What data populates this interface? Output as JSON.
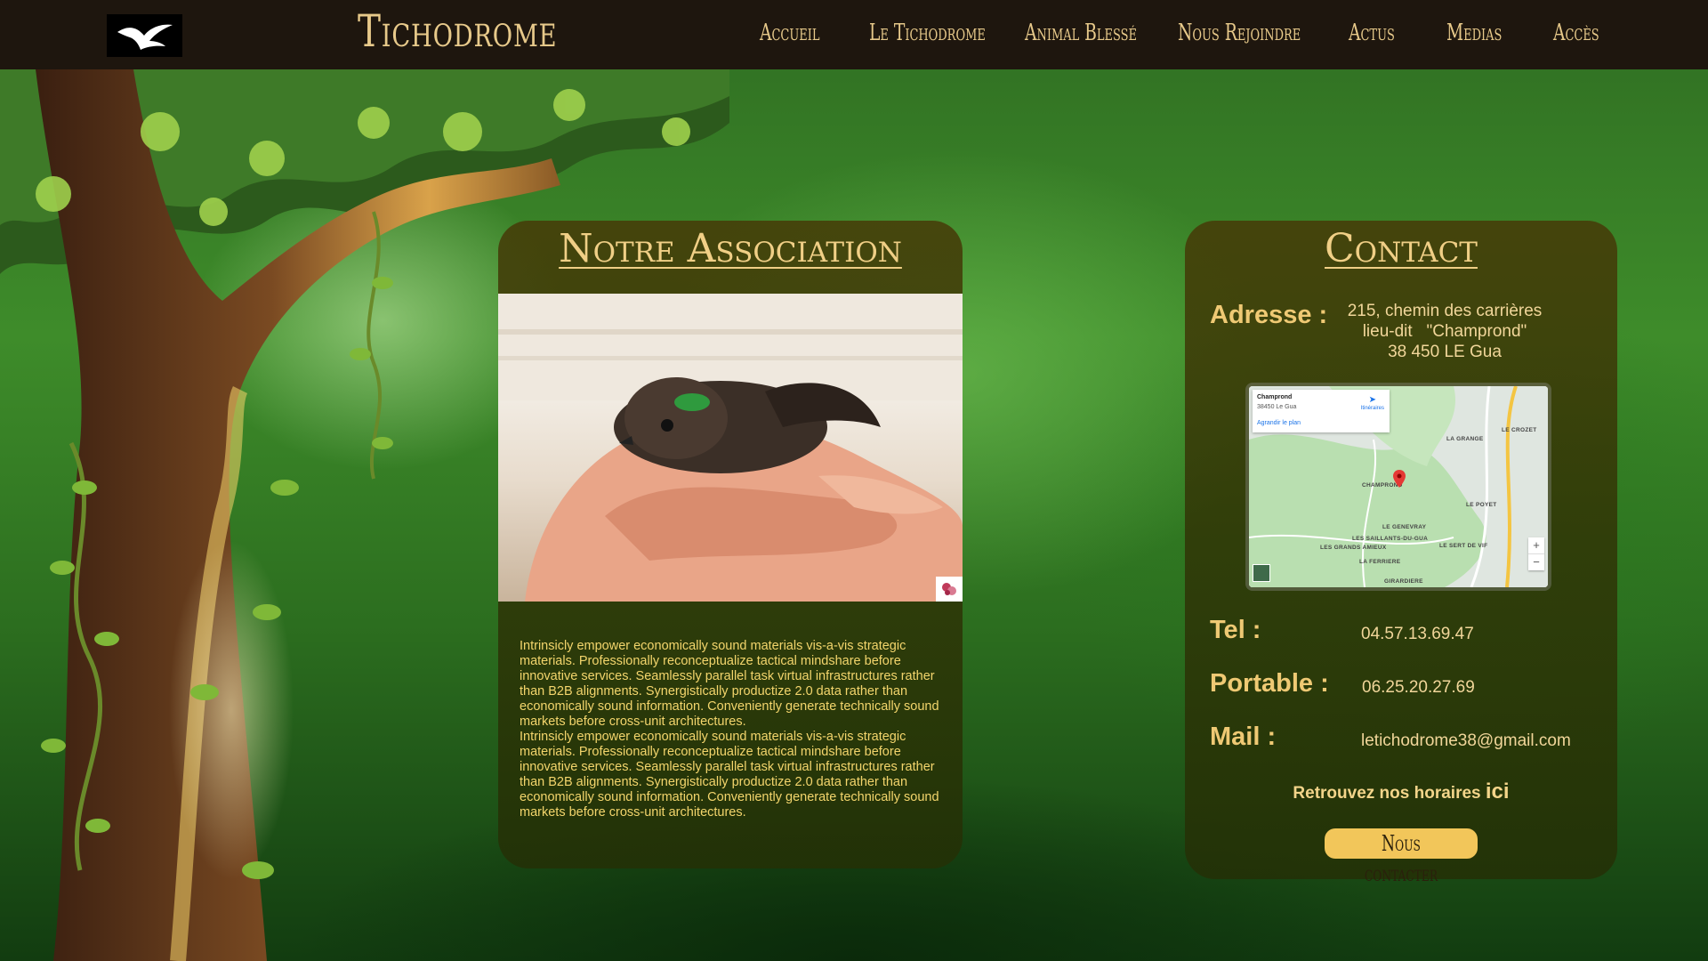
{
  "header": {
    "logo_icon": "seagull-icon",
    "site_title": "Tichodrome",
    "nav": [
      {
        "label": "Accueil"
      },
      {
        "label": "Le Tichodrome"
      },
      {
        "label": "Animal Blessé"
      },
      {
        "label": "Nous Rejoindre"
      },
      {
        "label": "Actus"
      },
      {
        "label": "Medias"
      },
      {
        "label": "Accès"
      }
    ]
  },
  "association": {
    "title": "Notre Association",
    "photo_icon": "bird-in-hand-photo",
    "paragraphs": [
      "Intrinsicly empower economically sound materials vis-a-vis strategic materials. Professionally reconceptualize tactical mindshare before innovative services. Seamlessly parallel task virtual infrastructures rather than B2B alignments. Synergistically productize 2.0 data rather than economically sound information. Conveniently generate technically sound markets before cross-unit architectures.",
      "Intrinsicly empower economically sound materials vis-a-vis strategic materials. Professionally reconceptualize tactical mindshare before innovative services. Seamlessly parallel task virtual infrastructures rather than B2B alignments. Synergistically productize 2.0 data rather than economically sound information. Conveniently generate technically sound markets before cross-unit architectures."
    ]
  },
  "contact": {
    "title": "Contact",
    "address_label": "Adresse :",
    "address_lines": [
      "215, chemin des carrières",
      "lieu-dit   \"Champrond\"",
      "38 450 LE Gua"
    ],
    "map": {
      "place_name": "Champrond",
      "place_sub": "38450 Le Gua",
      "enlarge_link": "Agrandir le plan",
      "directions": "Itinéraires",
      "labels": [
        "LA GRANGE",
        "LE CROZET",
        "CHAMPROND",
        "LE POYET",
        "LE GENEVRAY",
        "LES SAILLANTS-DU-GUA",
        "LES GRANDS AMIEUX",
        "LE SERT DE VIF",
        "LA FERRIERE",
        "GIRARDIERE"
      ],
      "zoom_in": "+",
      "zoom_out": "−"
    },
    "tel_label": "Tel :",
    "tel_value": "04.57.13.69.47",
    "mobile_label": "Portable :",
    "mobile_value": "06.25.20.27.69",
    "mail_label": "Mail :",
    "mail_value": "letichodrome38@gmail.com",
    "hours_text": "Retrouvez nos horaires",
    "hours_link": "ici",
    "button_label": "Nous contacter"
  },
  "colors": {
    "header_bg": "#1e160e",
    "accent_gold": "#e7c98a",
    "button_bg": "#f2c65a",
    "panel_text": "#f3d56c"
  }
}
